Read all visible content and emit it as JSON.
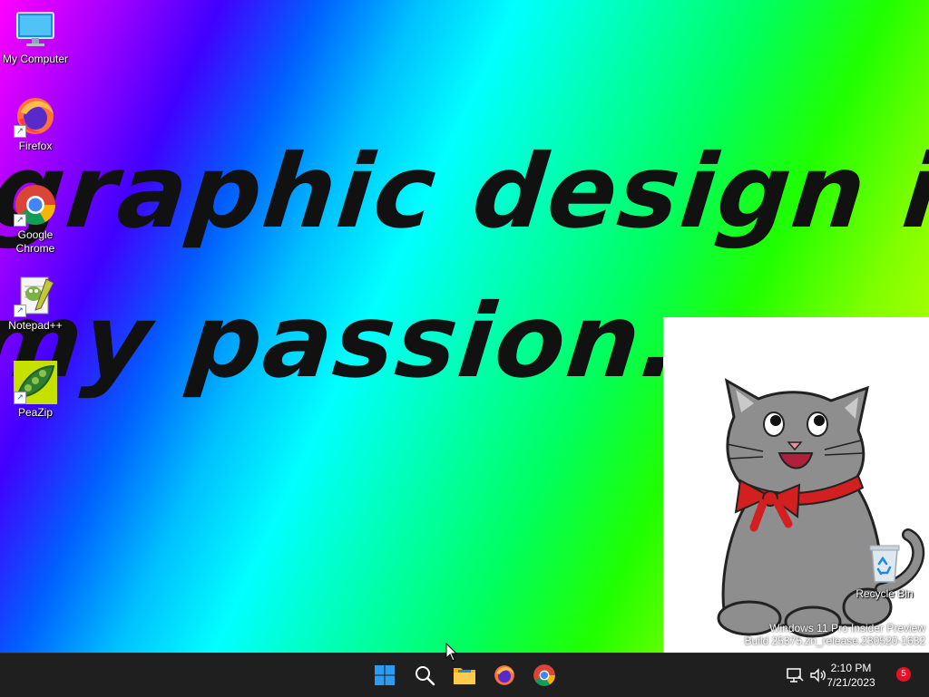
{
  "desktop": {
    "wallpaper_text": {
      "line1": "graphic design is",
      "line2": "my passion."
    },
    "icons": [
      {
        "label": "My Computer",
        "icon": "monitor-icon"
      },
      {
        "label": "Firefox",
        "icon": "firefox-icon"
      },
      {
        "label": "Google Chrome",
        "icon": "chrome-icon"
      },
      {
        "label": "Notepad++",
        "icon": "notepadpp-icon"
      },
      {
        "label": "PeaZip",
        "icon": "peazip-icon"
      },
      {
        "label": "Recycle Bin",
        "icon": "recycle-bin-icon"
      }
    ],
    "watermark": {
      "line1": "Windows 11 Pro Insider Preview",
      "line2": "Build 25375.zn_release.230520-1632"
    }
  },
  "taskbar": {
    "pinned": [
      {
        "name": "Start",
        "icon": "windows-start-icon"
      },
      {
        "name": "Search",
        "icon": "search-icon"
      },
      {
        "name": "File Explorer",
        "icon": "folder-icon"
      },
      {
        "name": "Firefox",
        "icon": "firefox-icon"
      },
      {
        "name": "Google Chrome",
        "icon": "chrome-icon"
      }
    ],
    "tray": {
      "time": "2:10 PM",
      "date": "7/21/2023",
      "notification_count": "5"
    }
  },
  "colors": {
    "taskbar_bg": "#1f1f1f",
    "notification_badge": "#e81123",
    "start_blue": "#0078d4"
  }
}
